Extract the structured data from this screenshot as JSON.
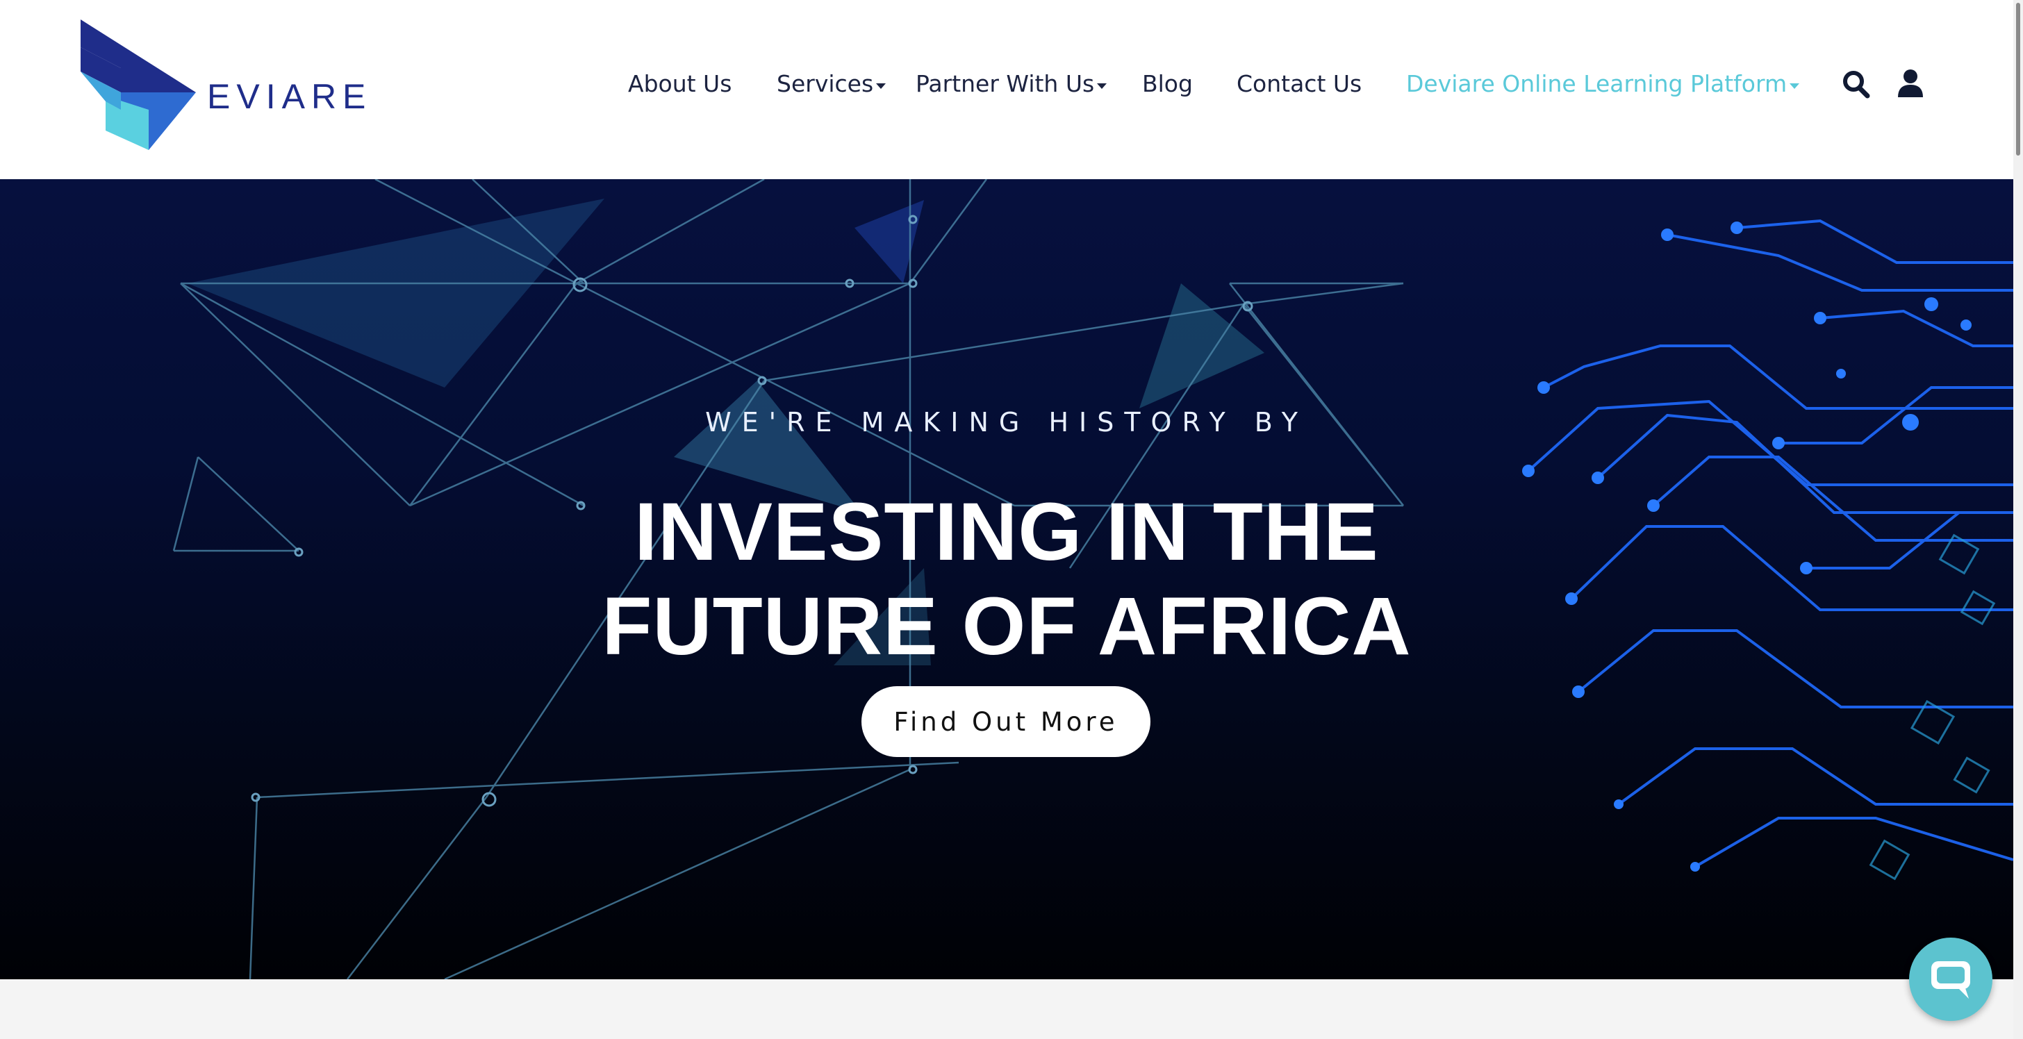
{
  "brand": {
    "logo_text": "EVIARE"
  },
  "nav": {
    "items": [
      {
        "label": "About Us"
      },
      {
        "label": "Services"
      },
      {
        "label": "Partner With Us"
      },
      {
        "label": "Blog"
      },
      {
        "label": "Contact Us"
      },
      {
        "label": "Deviare Online Learning Platform"
      }
    ],
    "search_icon": "search-icon",
    "account_icon": "user-icon"
  },
  "hero": {
    "eyebrow": "WE'RE MAKING HISTORY BY",
    "title_line1": "INVESTING IN THE",
    "title_line2": "FUTURE OF AFRICA",
    "cta_label": "Find Out More"
  },
  "chat": {
    "icon": "chat-bubble-icon"
  },
  "colors": {
    "brand_navy": "#1f2d8a",
    "brand_teal": "#5ac9d9",
    "nav_text": "#1c2340",
    "hero_dark": "#020719"
  }
}
